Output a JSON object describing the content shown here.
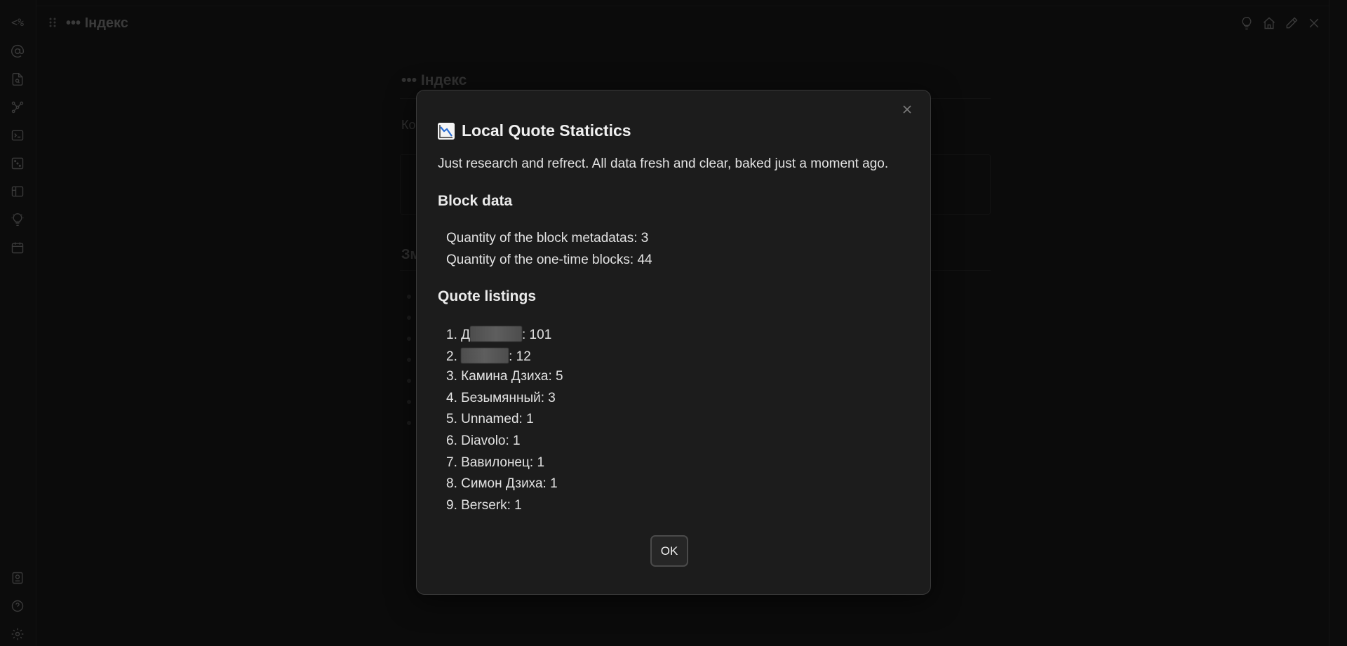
{
  "ribbon": {
    "top_label": "<%",
    "icons": [
      "mention-icon",
      "file-search-icon",
      "graph-icon",
      "terminal-icon",
      "dice-icon",
      "layout-icon",
      "lightbulb-icon",
      "calendar-icon"
    ],
    "bottom_icons": [
      "vault-icon",
      "help-icon",
      "settings-icon"
    ]
  },
  "tab": {
    "title": "••• Індекс",
    "actions": [
      "lightbulb-icon",
      "home-icon",
      "edit-icon",
      "close-icon"
    ]
  },
  "background": {
    "title": "••• Індекс",
    "text_fragment": "Ко",
    "heading_fragment": "Зм"
  },
  "modal": {
    "title": "Local Quote Statictics",
    "title_icon": "chart-decreasing-icon",
    "description": "Just research and refrect. All data fresh and clear, baked just a moment ago.",
    "block_section": {
      "heading": "Block data",
      "lines": [
        "Quantity of the block metadatas: 3",
        "Quantity of the one-time blocks: 44"
      ]
    },
    "quote_section": {
      "heading": "Quote listings",
      "items": [
        {
          "num": "1. ",
          "prefix": "Д",
          "name": "",
          "count": ": 101",
          "redacted": true
        },
        {
          "num": "2. ",
          "prefix": "",
          "name": "",
          "count": ": 12",
          "redacted": true
        },
        {
          "num": "3. ",
          "prefix": "",
          "name": "Камина Дзиха",
          "count": ": 5",
          "redacted": false
        },
        {
          "num": "4. ",
          "prefix": "",
          "name": "Безымянный",
          "count": ": 3",
          "redacted": false
        },
        {
          "num": "5. ",
          "prefix": "",
          "name": "Unnamed",
          "count": ": 1",
          "redacted": false
        },
        {
          "num": "6. ",
          "prefix": "",
          "name": "Diavolo",
          "count": ": 1",
          "redacted": false
        },
        {
          "num": "7. ",
          "prefix": "",
          "name": "Вавилонец",
          "count": ": 1",
          "redacted": false
        },
        {
          "num": "8. ",
          "prefix": "",
          "name": "Симон Дзиха",
          "count": ": 1",
          "redacted": false
        },
        {
          "num": "9. ",
          "prefix": "",
          "name": "Berserk",
          "count": ": 1",
          "redacted": false
        }
      ]
    },
    "ok_label": "OK"
  }
}
